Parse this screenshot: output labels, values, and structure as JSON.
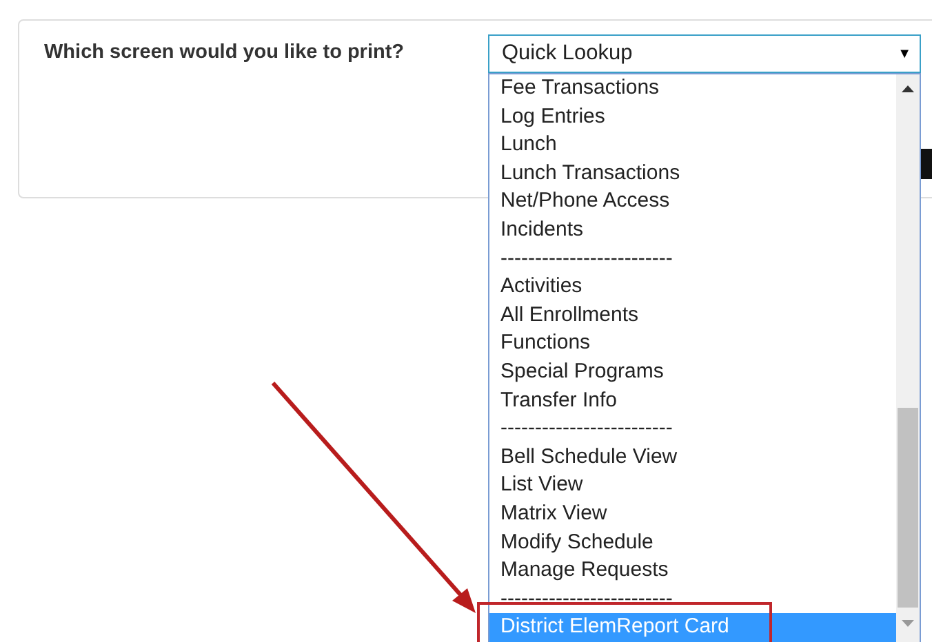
{
  "form": {
    "label": "Which screen would you like to print?"
  },
  "select": {
    "value": "Quick Lookup",
    "arrow": "▼",
    "expanded": true
  },
  "options": [
    {
      "label": "Fee Transactions",
      "selected": false
    },
    {
      "label": "Log Entries",
      "selected": false
    },
    {
      "label": "Lunch",
      "selected": false
    },
    {
      "label": "Lunch Transactions",
      "selected": false
    },
    {
      "label": "Net/Phone Access",
      "selected": false
    },
    {
      "label": "Incidents",
      "selected": false
    },
    {
      "label": "-------------------------",
      "selected": false
    },
    {
      "label": "Activities",
      "selected": false
    },
    {
      "label": "All Enrollments",
      "selected": false
    },
    {
      "label": "Functions",
      "selected": false
    },
    {
      "label": "Special Programs",
      "selected": false
    },
    {
      "label": "Transfer Info",
      "selected": false
    },
    {
      "label": "-------------------------",
      "selected": false
    },
    {
      "label": "Bell Schedule View",
      "selected": false
    },
    {
      "label": "List View",
      "selected": false
    },
    {
      "label": "Matrix View",
      "selected": false
    },
    {
      "label": "Modify Schedule",
      "selected": false
    },
    {
      "label": "Manage Requests",
      "selected": false
    },
    {
      "label": "-------------------------",
      "selected": false
    },
    {
      "label": "District ElemReport Card",
      "selected": true
    }
  ]
}
